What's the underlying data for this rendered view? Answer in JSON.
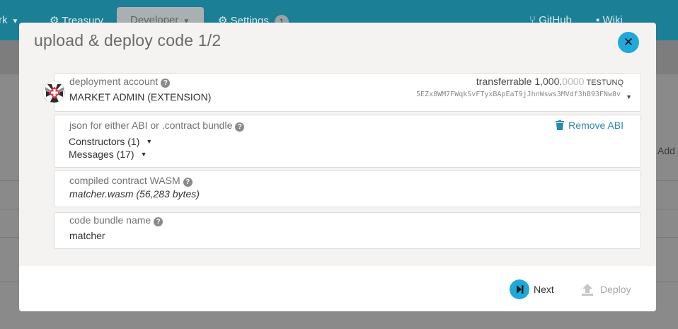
{
  "background": {
    "nav": {
      "network_partial": "rk",
      "treasury": "Treasury",
      "developer": "Developer",
      "settings": "Settings",
      "settings_badge": "1",
      "github": "GitHub",
      "wiki": "Wiki"
    },
    "add_partial": "Add"
  },
  "modal": {
    "title": "upload & deploy code 1/2",
    "close_icon": "close-icon",
    "account": {
      "label": "deployment account",
      "name": "MARKET ADMIN (EXTENSION)",
      "balance_label": "transferrable",
      "balance_main": "1,000.",
      "balance_decimals": "0000",
      "balance_unit": "TESTUNQ",
      "address": "5EZx8WM7FWqkSvFTyxBApEaT9jJhnWsws3MVdf3hB93FNw8v"
    },
    "abi": {
      "label": "json for either ABI or .contract bundle",
      "remove_label": "Remove ABI",
      "constructors_label": "Constructors (1)",
      "messages_label": "Messages (17)"
    },
    "wasm": {
      "label": "compiled contract WASM",
      "value": "matcher.wasm (56,283 bytes)"
    },
    "bundle_name": {
      "label": "code bundle name",
      "value": "matcher"
    },
    "footer": {
      "next_label": "Next",
      "deploy_label": "Deploy"
    }
  },
  "colors": {
    "accent": "#1fa8d9",
    "link": "#2a8aa6",
    "nav_bg": "#1b7f96"
  }
}
